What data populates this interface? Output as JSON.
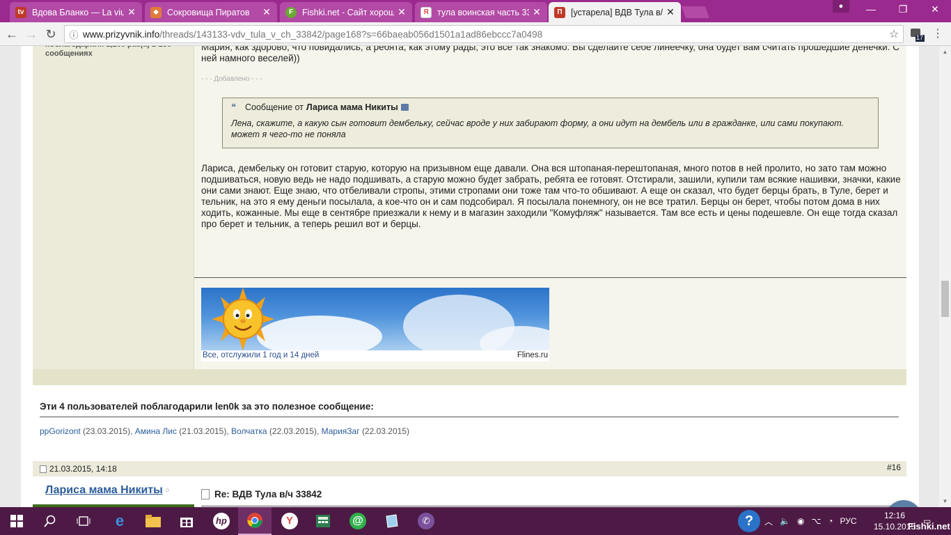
{
  "browser": {
    "tabs": [
      {
        "title": "Вдова Бланко — La viud",
        "favicon_color": "#c0392b",
        "favicon_text": "tv"
      },
      {
        "title": "Сокровища Пиратов",
        "favicon_color": "#e07b39",
        "favicon_text": "◆"
      },
      {
        "title": "Fishki.net - Сайт хороше",
        "favicon_color": "#6aa832",
        "favicon_text": "F"
      },
      {
        "title": "тула воинская часть 338",
        "favicon_color": "#e04b4b",
        "favicon_text": "Я"
      },
      {
        "title": "[устарела] ВДВ Тула в/ч",
        "favicon_color": "#c0392b",
        "favicon_text": "П"
      }
    ],
    "url_host": "www.prizyvnik.info",
    "url_path": "/threads/143133-vdv_tula_v_ch_33842/page168?s=66baeab056d1501a1ad86ebccc7a0498",
    "extension_badge": "17"
  },
  "post1": {
    "thanks_info": "поблагодарили 1,200 раз(а) в 250 сообщениях",
    "text_top": "Мария, как здорово, что повидались, а ребята, как этому рады, это все так знакомо. Вы сделайте себе линеечку, она будет вам считать прошедшие денечки. С ней намного веселей))",
    "added_label": "- - - Добавлено - - -",
    "quote_prefix": "Сообщение от",
    "quote_author": "Лариса мама Никиты",
    "quote_text": "Лена, скажите, а какую сын готовит дембельку, сейчас вроде у них забирают форму, а они идут на дембель или в гражданке, или сами покупают. может я чего-то не поняла",
    "reply_text": "Лариса, дембельку он готовит старую, которую на призывном еще давали. Она вся штопаная-перештопаная, много потов в ней пролито, но зато там можно подшиваться, новую ведь не надо подшивать, а старую можно будет забрать, ребята ее готовят. Отстирали, зашили, купили там всякие нашивки, значки, какие они сами знают. Еще знаю, что отбеливали стропы, этими стропами они тоже там что-то обшивают. А еще он сказал, что будет берцы брать, в Туле, берет и тельник, на это я ему деньги посылала, а кое-что он и сам подсобирал. Я посылала понемногу, он не все тратил. Берцы он берет, чтобы потом дома в них ходить, кожанные. Мы еще в сентябре приезжали к нему и в магазин заходили \"Комуфляж\" называется. Там все есть и цены подешевле. Он еще тогда сказал про берет и тельник, а теперь решил вот и берцы.",
    "banner_caption": "Все, отслужили 1 год  и 14 дней",
    "banner_source": "Flines.ru"
  },
  "thanks": {
    "heading": "Эти 4 пользователей поблагодарили len0k за это полезное сообщение:",
    "users": [
      {
        "name": "ppGorizont",
        "date": "(23.03.2015)"
      },
      {
        "name": "Амина Лис",
        "date": "(21.03.2015)"
      },
      {
        "name": "Волчатка",
        "date": "(22.03.2015)"
      },
      {
        "name": "МарияЗаг",
        "date": "(22.03.2015)"
      }
    ]
  },
  "post2": {
    "date": "21.03.2015, 14:18",
    "number": "#16",
    "author": "Лариса мама Никиты",
    "status_dot": "○",
    "title": "Re: ВДВ Тула в/ч 33842"
  },
  "vk_label": "VK",
  "taskbar": {
    "lang": "РУС",
    "time": "12:16",
    "date": "15.10.2015",
    "help_label": "?"
  },
  "watermark": "Fishki.net"
}
